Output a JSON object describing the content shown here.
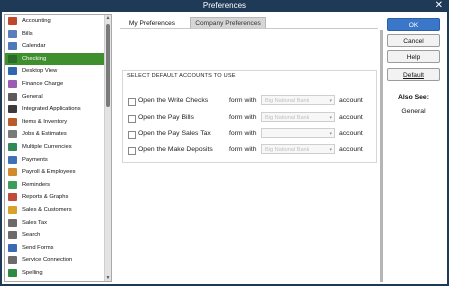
{
  "window": {
    "title": "Preferences",
    "close_glyph": "✕"
  },
  "sidebar": {
    "items": [
      {
        "label": "Accounting",
        "icon": "accounting-icon",
        "color": "#c0472e"
      },
      {
        "label": "Bills",
        "icon": "bills-icon",
        "color": "#5a7dbb"
      },
      {
        "label": "Calendar",
        "icon": "calendar-icon",
        "color": "#4f79b9"
      },
      {
        "label": "Checking",
        "icon": "checking-icon",
        "color": "#2a6b2a"
      },
      {
        "label": "Desktop View",
        "icon": "desktop-view-icon",
        "color": "#2f66b0"
      },
      {
        "label": "Finance Charge",
        "icon": "finance-charge-icon",
        "color": "#9a5bb3"
      },
      {
        "label": "General",
        "icon": "general-icon",
        "color": "#5b5b5b"
      },
      {
        "label": "Integrated Applications",
        "icon": "integrated-applications-icon",
        "color": "#3b3b3b"
      },
      {
        "label": "Items & Inventory",
        "icon": "items-inventory-icon",
        "color": "#b85c2c"
      },
      {
        "label": "Jobs & Estimates",
        "icon": "jobs-estimates-icon",
        "color": "#7a7a7a"
      },
      {
        "label": "Multiple Currencies",
        "icon": "multiple-currencies-icon",
        "color": "#2e8b57"
      },
      {
        "label": "Payments",
        "icon": "payments-icon",
        "color": "#3d73b6"
      },
      {
        "label": "Payroll & Employees",
        "icon": "payroll-employees-icon",
        "color": "#d08b2f"
      },
      {
        "label": "Reminders",
        "icon": "reminders-icon",
        "color": "#3c9c5a"
      },
      {
        "label": "Reports & Graphs",
        "icon": "reports-graphs-icon",
        "color": "#c14b3a"
      },
      {
        "label": "Sales & Customers",
        "icon": "sales-customers-icon",
        "color": "#d6a22b"
      },
      {
        "label": "Sales Tax",
        "icon": "sales-tax-icon",
        "color": "#6b6b6b"
      },
      {
        "label": "Search",
        "icon": "search-icon",
        "color": "#6b6b6b"
      },
      {
        "label": "Send Forms",
        "icon": "send-forms-icon",
        "color": "#3c69b4"
      },
      {
        "label": "Service Connection",
        "icon": "service-connection-icon",
        "color": "#6b6b6b"
      },
      {
        "label": "Spelling",
        "icon": "spelling-icon",
        "color": "#2f8a42"
      }
    ],
    "selected_index": 3
  },
  "tabs": {
    "my": "My Preferences",
    "company": "Company Preferences"
  },
  "section": {
    "title": "SELECT DEFAULT ACCOUNTS TO USE",
    "form_with": "form with",
    "account": "account",
    "rows": [
      {
        "label": "Open the Write Checks",
        "dropdown": "Big National Bank",
        "checked": false
      },
      {
        "label": "Open the Pay Bills",
        "dropdown": "Big National Bank",
        "checked": false
      },
      {
        "label": "Open the Pay Sales Tax",
        "dropdown": "",
        "checked": false
      },
      {
        "label": "Open the Make Deposits",
        "dropdown": "Big National Bank",
        "checked": false
      }
    ]
  },
  "buttons": {
    "ok": "OK",
    "cancel": "Cancel",
    "help": "Help",
    "default": "Default"
  },
  "also_see": {
    "title": "Also See:",
    "link": "General"
  }
}
